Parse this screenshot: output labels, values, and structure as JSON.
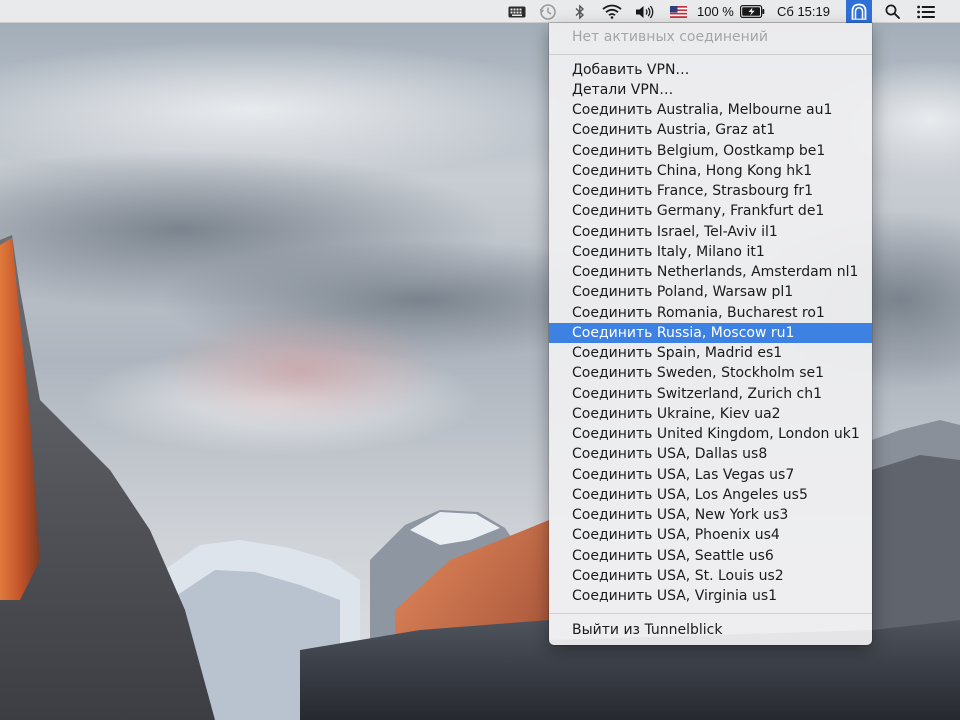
{
  "menubar": {
    "battery_percent": "100 %",
    "clock": "Сб 15:19",
    "icons": [
      "keyboard-icon",
      "time-machine-icon",
      "bluetooth-icon",
      "wifi-icon",
      "volume-icon",
      "us-flag-icon",
      "battery-icon",
      "tunnelblick-icon",
      "spotlight-icon",
      "notification-center-icon"
    ],
    "accent_color": "#2f6fd8"
  },
  "menu": {
    "status": "Нет активных соединений",
    "add_vpn": "Добавить VPN…",
    "vpn_details": "Детали VPN…",
    "connections": [
      "Соединить Australia, Melbourne au1",
      "Соединить Austria, Graz at1",
      "Соединить Belgium, Oostkamp be1",
      "Соединить China, Hong Kong hk1",
      "Соединить France, Strasbourg fr1",
      "Соединить Germany, Frankfurt de1",
      "Соединить Israel, Tel-Aviv il1",
      "Соединить Italy, Milano it1",
      "Соединить Netherlands, Amsterdam nl1",
      "Соединить Poland, Warsaw pl1",
      "Соединить Romania, Bucharest ro1",
      "Соединить Russia, Moscow ru1",
      "Соединить Spain, Madrid es1",
      "Соединить Sweden, Stockholm se1",
      "Соединить Switzerland, Zurich ch1",
      "Соединить Ukraine, Kiev ua2",
      "Соединить United Kingdom, London uk1",
      "Соединить USA, Dallas us8",
      "Соединить USA, Las Vegas us7",
      "Соединить USA, Los Angeles us5",
      "Соединить USA, New York us3",
      "Соединить USA, Phoenix us4",
      "Соединить USA, Seattle us6",
      "Соединить USA, St. Louis us2",
      "Соединить USA, Virginia us1"
    ],
    "highlighted_connection": "Соединить Russia, Moscow ru1",
    "quit": "Выйти из Tunnelblick",
    "highlight_color": "#3d82e3"
  }
}
